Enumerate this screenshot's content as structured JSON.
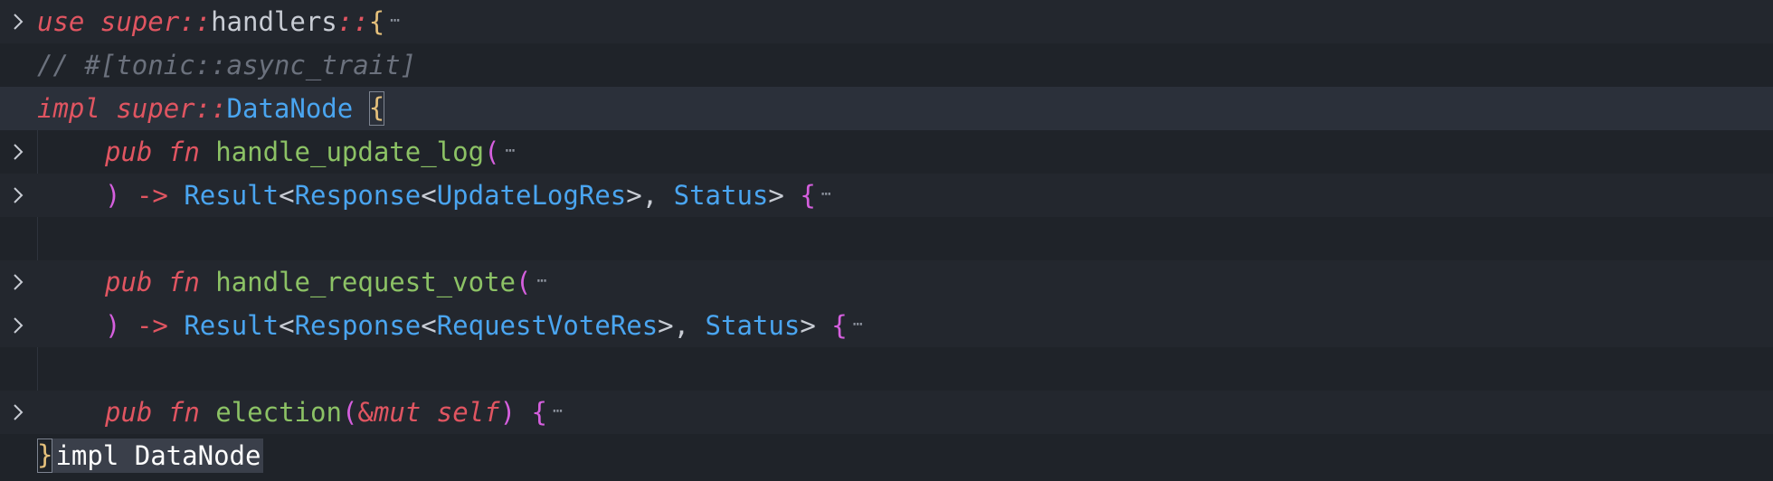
{
  "editor": {
    "lines": [
      {
        "folded": true,
        "tokens": [
          {
            "text": "use",
            "style": "kw"
          },
          {
            "text": " ",
            "style": "pl"
          },
          {
            "text": "super",
            "style": "kw"
          },
          {
            "text": "::",
            "style": "kw"
          },
          {
            "text": "handlers",
            "style": "pl"
          },
          {
            "text": "::",
            "style": "kw"
          },
          {
            "text": "{",
            "style": "yl"
          }
        ]
      },
      {
        "folded": false,
        "tokens": [
          {
            "text": "// #[tonic::async_trait]",
            "style": "cm"
          }
        ]
      },
      {
        "folded": false,
        "tokens": [
          {
            "text": "impl",
            "style": "kw"
          },
          {
            "text": " ",
            "style": "pl"
          },
          {
            "text": "super",
            "style": "kw"
          },
          {
            "text": "::",
            "style": "kw"
          },
          {
            "text": "DataNode",
            "style": "ty"
          },
          {
            "text": " ",
            "style": "pl"
          },
          {
            "text": "{",
            "style": "yl"
          }
        ]
      },
      {
        "folded": true,
        "tokens": [
          {
            "text": "pub",
            "style": "kw"
          },
          {
            "text": " ",
            "style": "pl"
          },
          {
            "text": "fn",
            "style": "kw"
          },
          {
            "text": " ",
            "style": "pl"
          },
          {
            "text": "handle_update_log",
            "style": "fn"
          },
          {
            "text": "(",
            "style": "pu"
          }
        ]
      },
      {
        "folded": true,
        "tokens": [
          {
            "text": ")",
            "style": "pu"
          },
          {
            "text": " ",
            "style": "pl"
          },
          {
            "text": "->",
            "style": "kwn"
          },
          {
            "text": " ",
            "style": "pl"
          },
          {
            "text": "Result",
            "style": "ty"
          },
          {
            "text": "<",
            "style": "pl"
          },
          {
            "text": "Response",
            "style": "ty"
          },
          {
            "text": "<",
            "style": "pl"
          },
          {
            "text": "UpdateLogRes",
            "style": "ty"
          },
          {
            "text": ">, ",
            "style": "pl"
          },
          {
            "text": "Status",
            "style": "ty"
          },
          {
            "text": "> ",
            "style": "pl"
          },
          {
            "text": "{",
            "style": "pu"
          }
        ]
      },
      {
        "folded": false,
        "tokens": []
      },
      {
        "folded": true,
        "tokens": [
          {
            "text": "pub",
            "style": "kw"
          },
          {
            "text": " ",
            "style": "pl"
          },
          {
            "text": "fn",
            "style": "kw"
          },
          {
            "text": " ",
            "style": "pl"
          },
          {
            "text": "handle_request_vote",
            "style": "fn"
          },
          {
            "text": "(",
            "style": "pu"
          }
        ]
      },
      {
        "folded": true,
        "tokens": [
          {
            "text": ")",
            "style": "pu"
          },
          {
            "text": " ",
            "style": "pl"
          },
          {
            "text": "->",
            "style": "kwn"
          },
          {
            "text": " ",
            "style": "pl"
          },
          {
            "text": "Result",
            "style": "ty"
          },
          {
            "text": "<",
            "style": "pl"
          },
          {
            "text": "Response",
            "style": "ty"
          },
          {
            "text": "<",
            "style": "pl"
          },
          {
            "text": "RequestVoteRes",
            "style": "ty"
          },
          {
            "text": ">, ",
            "style": "pl"
          },
          {
            "text": "Status",
            "style": "ty"
          },
          {
            "text": "> ",
            "style": "pl"
          },
          {
            "text": "{",
            "style": "pu"
          }
        ]
      },
      {
        "folded": false,
        "tokens": []
      },
      {
        "folded": true,
        "tokens": [
          {
            "text": "pub",
            "style": "kw"
          },
          {
            "text": " ",
            "style": "pl"
          },
          {
            "text": "fn",
            "style": "kw"
          },
          {
            "text": " ",
            "style": "pl"
          },
          {
            "text": "election",
            "style": "fn"
          },
          {
            "text": "(",
            "style": "pu"
          },
          {
            "text": "&",
            "style": "kwn"
          },
          {
            "text": "mut",
            "style": "kw"
          },
          {
            "text": " ",
            "style": "pl"
          },
          {
            "text": "self",
            "style": "kw"
          },
          {
            "text": ")",
            "style": "pu"
          },
          {
            "text": " ",
            "style": "pl"
          },
          {
            "text": "{",
            "style": "pu"
          }
        ]
      },
      {
        "folded": false,
        "tokens": [
          {
            "text": "}",
            "style": "yl"
          }
        ]
      }
    ],
    "fold_ellipsis": "⋯",
    "inlay_hint": "impl DataNode",
    "colors": {
      "background": "#1f2329",
      "keyword": "#e05561",
      "type": "#4aa5f0",
      "function": "#8cc265",
      "punctuation": "#d55fde",
      "bracket": "#e5c07b",
      "comment": "#6b717d",
      "text": "#c8ccd4"
    },
    "icons": {
      "fold_marker": "chevron-right-icon"
    }
  }
}
